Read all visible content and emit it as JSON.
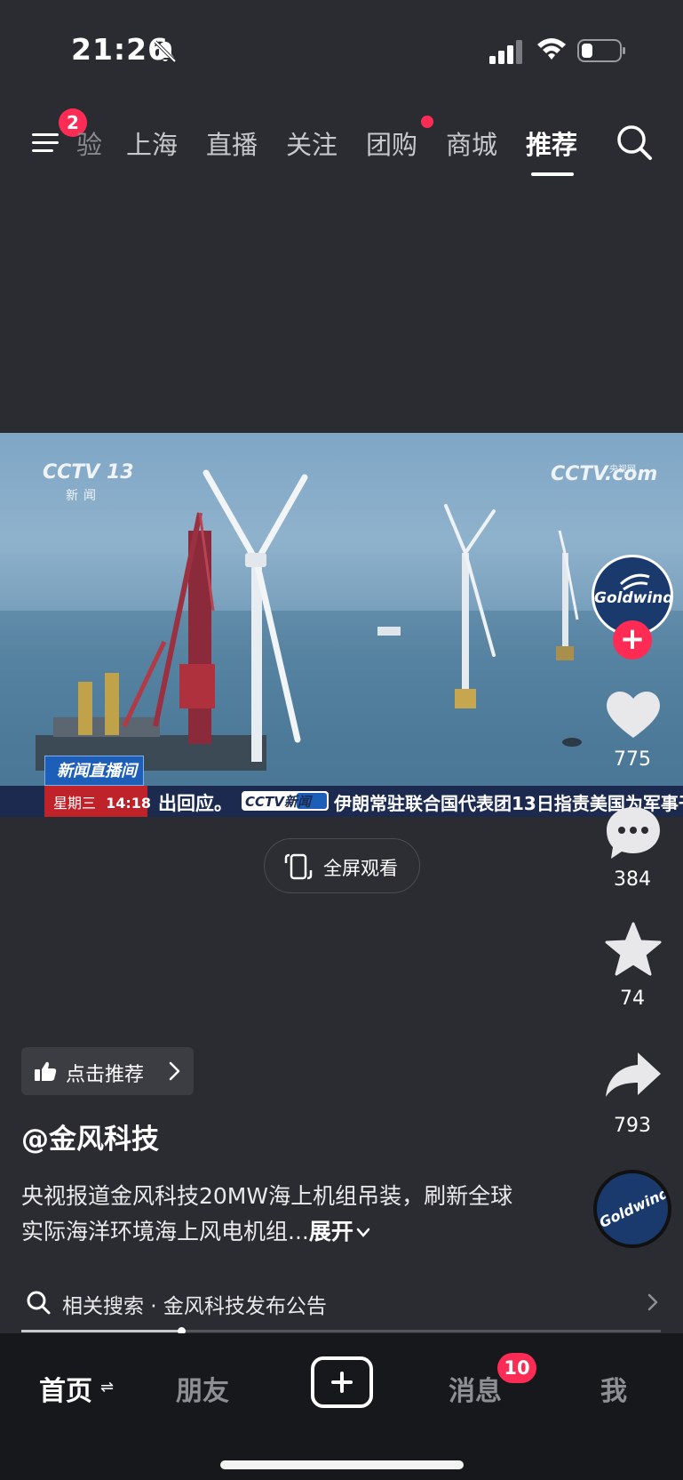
{
  "status_bar": {
    "time": "21:26"
  },
  "top_nav": {
    "menu_badge": "2",
    "tabs": [
      {
        "label": "验",
        "state": "faded"
      },
      {
        "label": "上海",
        "state": "normal"
      },
      {
        "label": "直播",
        "state": "normal"
      },
      {
        "label": "关注",
        "state": "normal"
      },
      {
        "label": "团购",
        "state": "normal",
        "dot": true
      },
      {
        "label": "商城",
        "state": "normal"
      },
      {
        "label": "推荐",
        "state": "active"
      }
    ]
  },
  "video": {
    "channel_logo": "CCTV 13",
    "channel_sub": "新闻",
    "site_logo": "CCTV.com",
    "site_logo_sub": "央视网",
    "program_box": "新闻直播间",
    "weekday": "星期三",
    "clock": "14:18",
    "ticker_left": "出回应。",
    "ticker_logo": "CCTV新闻",
    "ticker_right": "伊朗常驻联合国代表团13日指责美国为军事干"
  },
  "fullscreen": {
    "label": "全屏观看"
  },
  "sidebar": {
    "avatar_text": "Goldwind",
    "like_count": "775",
    "comment_count": "384",
    "favorite_count": "74",
    "share_count": "793",
    "music_text": "Goldwind"
  },
  "content": {
    "recommend_label": "点击推荐",
    "author": "@金风科技",
    "description": "央视报道金风科技20MW海上机组吊装，刷新全球实际海洋环境海上风电机组...",
    "expand_label": "展开",
    "related_search": "相关搜索 · 金风科技发布公告",
    "progress": 0.25
  },
  "bottom_nav": {
    "home": "首页",
    "friends": "朋友",
    "messages": "消息",
    "messages_badge": "10",
    "me": "我"
  },
  "colors": {
    "accent": "#fe2c55",
    "background": "#2a2c31",
    "bottom_bar": "#17181c"
  }
}
